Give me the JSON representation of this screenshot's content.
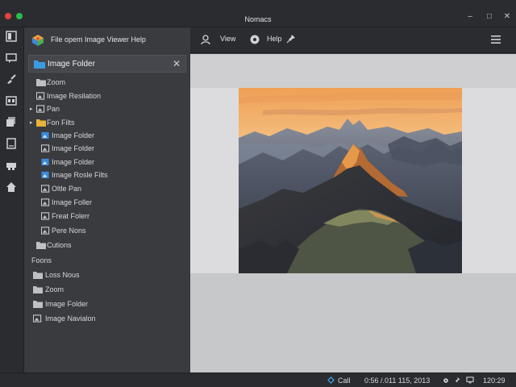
{
  "window": {
    "title": "Nomacs",
    "controls": {
      "minimize": "–",
      "maximize": "□",
      "close": "✕"
    }
  },
  "rail": {
    "icons": [
      "panel-icon",
      "chat-icon",
      "brush-icon",
      "grid-icon",
      "stack-icon",
      "book-icon",
      "printer-icon",
      "home-icon"
    ]
  },
  "menubar": {
    "text": "File opem Image Viewer  Help"
  },
  "folder_header": {
    "label": "Image Folder",
    "close": "✕"
  },
  "tree": {
    "items": [
      {
        "label": "Zoom",
        "icon": "folder-gray",
        "arrow": ""
      },
      {
        "label": "Image Resilation",
        "icon": "image-gray",
        "arrow": ""
      },
      {
        "label": "Pan",
        "icon": "image-gray",
        "arrow": "▸"
      },
      {
        "label": "Fon Filts",
        "icon": "folder-yellow",
        "arrow": "▸"
      },
      {
        "label": "Image Folder",
        "icon": "image-blue",
        "arrow": ""
      },
      {
        "label": "Image Folder",
        "icon": "image-gray",
        "arrow": ""
      },
      {
        "label": "Image Folder",
        "icon": "image-blue",
        "arrow": ""
      },
      {
        "label": "Image Rosle Filts",
        "icon": "image-blue",
        "arrow": ""
      },
      {
        "label": "Oltle Pan",
        "icon": "image-gray",
        "arrow": ""
      },
      {
        "label": "Image Foller",
        "icon": "image-gray",
        "arrow": ""
      },
      {
        "label": "Freat Folerr",
        "icon": "image-gray",
        "arrow": ""
      },
      {
        "label": "Pere Nons",
        "icon": "image-gray",
        "arrow": ""
      },
      {
        "label": "Cutions",
        "icon": "folder-gray",
        "arrow": ""
      }
    ],
    "section_label": "Foons",
    "section_items": [
      {
        "label": "Loss Nous",
        "icon": "folder-gray"
      },
      {
        "label": "Zoom",
        "icon": "folder-gray"
      },
      {
        "label": "Image Folder",
        "icon": "folder-gray"
      },
      {
        "label": "Image Navialon",
        "icon": "image-gray"
      }
    ]
  },
  "toolbar": {
    "view_label": "View",
    "help_label": "Help",
    "icons": [
      "user-icon",
      "gear-icon",
      "pin-icon",
      "hamburger-icon"
    ]
  },
  "viewer": {
    "image_subject": "mountain-landscape",
    "colors": {
      "sky_top": "#f2a95a",
      "sky_bottom": "#f5d7a4",
      "peak_light": "#d58a3c",
      "shadow": "#2c3038"
    }
  },
  "statusbar": {
    "call_label": "Call",
    "info": "0:56 /.011 115, 2013",
    "time": "120:29"
  }
}
